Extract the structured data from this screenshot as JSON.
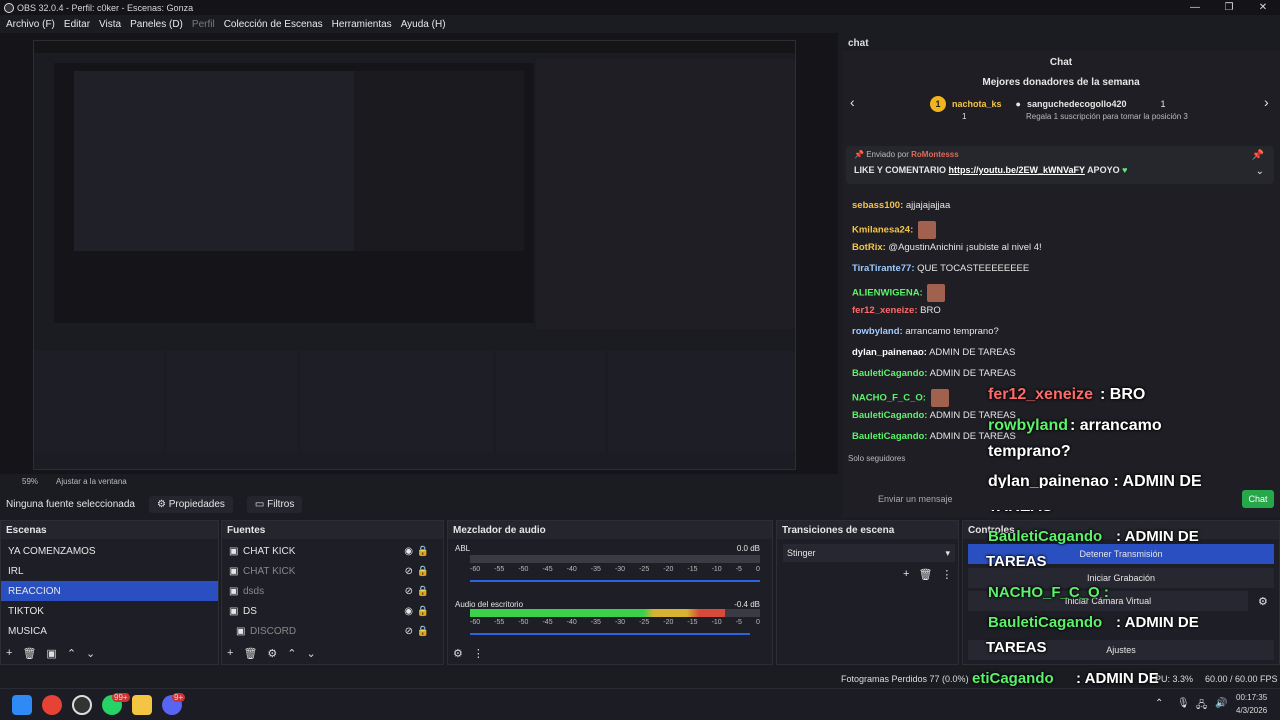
{
  "window": {
    "title": "OBS 32.0.4 - Perfil: c0ker - Escenas: Gonza"
  },
  "menu": [
    "Archivo (F)",
    "Editar",
    "Vista",
    "Paneles (D)",
    "Perfil",
    "Colección de Escenas",
    "Herramientas",
    "Ayuda (H)"
  ],
  "zoom": {
    "value": "59%",
    "fit_label": "Ajustar a la ventana"
  },
  "source_bar": {
    "none_selected": "Ninguna fuente seleccionada",
    "properties": "Propiedades",
    "filters": "Filtros"
  },
  "chat": {
    "tab": "chat",
    "title": "Chat",
    "donors_title": "Mejores donadores de la semana",
    "donor_name": "nachota_ks",
    "donor_count": "1",
    "donor2_name": "sanguchedecogollo420",
    "donor2_count": "1",
    "donor_hint": "Regala 1 suscripción para tomar la posición 3",
    "pinned_by_label": "Enviado por",
    "pinned_by_user": "RoMontesss",
    "pinned_message": "LIKE Y COMENTARIO",
    "pinned_link": "https://youtu.be/2EW_kWNVaFY",
    "pinned_suffix": "APOYO",
    "followers_only": "Solo seguidores",
    "input_placeholder": "Enviar un mensaje",
    "send_button": "Chat",
    "messages": [
      {
        "user": "sebass100:",
        "text": "ajjajajajjaa",
        "color": "#f4c54a"
      },
      {
        "user": "Kmilanesa24:",
        "text": "",
        "color": "#f4c54a"
      },
      {
        "user": "BotRix:",
        "text": "@AgustinAnichini ¡subiste al nivel 4!",
        "color": "#f4c54a"
      },
      {
        "user": "TiraTirante77:",
        "text": "QUE TOCASTEEEEEEEE",
        "color": "#9ecbff"
      },
      {
        "user": "ALIENWIGENA:",
        "text": "",
        "color": "#5cf26b"
      },
      {
        "user": "fer12_xeneize:",
        "text": "BRO",
        "color": "#ff6a6a"
      },
      {
        "user": "rowbyland:",
        "text": "arrancamo temprano?",
        "color": "#9ecbff"
      },
      {
        "user": "dylan_painenao:",
        "text": "ADMIN DE TAREAS",
        "color": "#ffffff"
      },
      {
        "user": "BauletiCagando:",
        "text": "ADMIN DE TAREAS",
        "color": "#5cf26b"
      },
      {
        "user": "NACHO_F_C_O:",
        "text": "",
        "color": "#5cf26b"
      },
      {
        "user": "BauletiCagando:",
        "text": "ADMIN DE TAREAS",
        "color": "#5cf26b"
      },
      {
        "user": "BauletiCagando:",
        "text": "ADMIN DE TAREAS",
        "color": "#5cf26b"
      }
    ]
  },
  "overlay": {
    "fer12": "fer12_xeneize",
    "bro": ": BRO",
    "rowby": "rowbyland",
    "rowby_msg": ": arrancamo",
    "rowby_msg2": "temprano?",
    "dylan": "dylan_painenao : ADMIN DE",
    "tareas": "TAREAS",
    "baul1": "BauletiCagando",
    "admin": ": ADMIN DE",
    "nacho": "NACHO_F_C_O :",
    "baul2": "BauletiCagando",
    "baul3": "etiCagando",
    "as": "AS"
  },
  "scenes": {
    "title": "Escenas",
    "items": [
      "YA COMENZAMOS",
      "IRL",
      "REACCION",
      "TIKTOK",
      "MUSICA"
    ],
    "selected": 2
  },
  "sources": {
    "title": "Fuentes",
    "items": [
      {
        "name": "CHAT KICK",
        "dim": false
      },
      {
        "name": "CHAT KICK",
        "dim": true
      },
      {
        "name": "dsds",
        "dim": true
      },
      {
        "name": "DS",
        "dim": false
      },
      {
        "name": "DISCORD",
        "dim": true
      }
    ]
  },
  "mixer": {
    "title": "Mezclador de audio",
    "ch1": {
      "name": "ABL",
      "db": "0.0 dB",
      "level": 0.0
    },
    "ch2": {
      "name": "Audio del escritorio",
      "db": "-0.4 dB",
      "level": 0.88
    },
    "ticks": [
      "-60",
      "-55",
      "-50",
      "-45",
      "-40",
      "-35",
      "-30",
      "-25",
      "-20",
      "-15",
      "-10",
      "-5",
      "0"
    ]
  },
  "transitions": {
    "title": "Transiciones de escena",
    "selected": "Stinger"
  },
  "controls": {
    "title": "Controles",
    "stop_stream": "Detener Transmisión",
    "start_record": "Iniciar Grabación",
    "virtual_cam": "Iniciar Cámara Virtual",
    "settings": "Ajustes"
  },
  "status": {
    "frames_lost": "Fotogramas Perdidos 77 (0.0%)",
    "cpu": "PU: 3.3%",
    "fps": "60.00 / 60.00 FPS"
  },
  "taskbar": {
    "time": "00:17:35",
    "date": "4/3/2026",
    "whatsapp_badge": "99+",
    "discord_badge": "9+"
  },
  "colors": {
    "accent": "#2a4fc0",
    "kick_green": "#25a74a",
    "bg": "#1b1c22"
  }
}
